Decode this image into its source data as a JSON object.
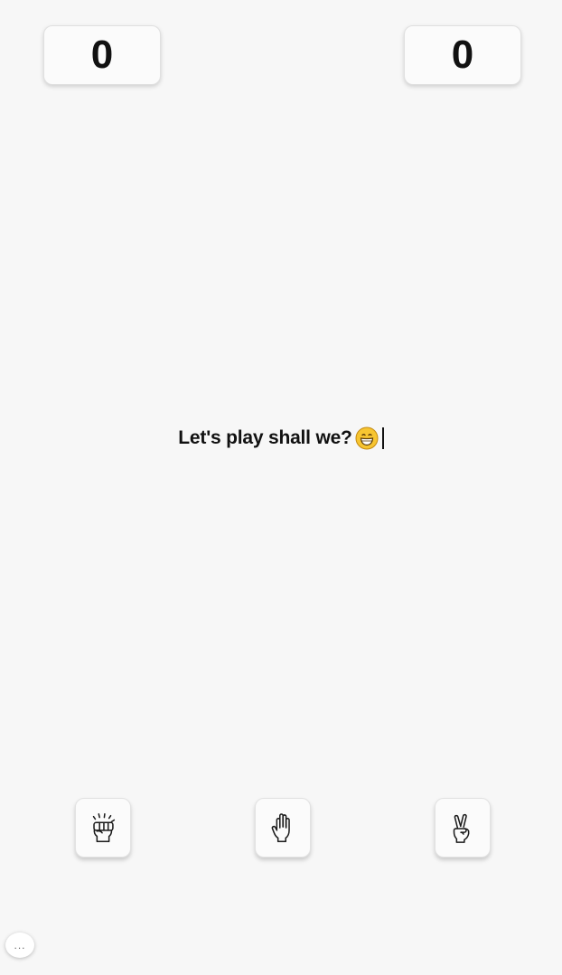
{
  "scores": {
    "player": "0",
    "computer": "0"
  },
  "message": {
    "text": "Let's play shall we?",
    "emoji": "grinning-face-emoji"
  },
  "choices": [
    {
      "name": "rock",
      "icon": "rock-fist-icon"
    },
    {
      "name": "paper",
      "icon": "paper-hand-icon"
    },
    {
      "name": "scissors",
      "icon": "scissors-victory-hand-icon"
    }
  ],
  "chat_bubble": {
    "label": "...",
    "icon": "chat-bubble-icon"
  },
  "colors": {
    "background": "#f7f7f7",
    "card": "#fbfbfb",
    "text": "#111111",
    "emoji": "#f7c531"
  }
}
